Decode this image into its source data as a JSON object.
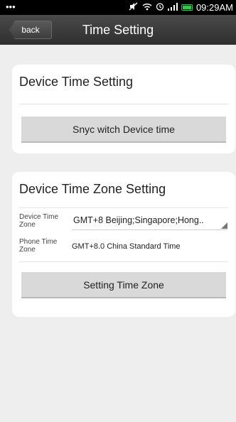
{
  "status_bar": {
    "dots": "•••",
    "time": "09:29AM",
    "icons": [
      "mute-icon",
      "wifi-icon",
      "alarm-icon",
      "signal-icon",
      "battery-icon"
    ]
  },
  "header": {
    "back_label": "back",
    "title": "Time Setting"
  },
  "device_time": {
    "title": "Device Time Setting",
    "sync_button": "Snyc witch Device time"
  },
  "time_zone": {
    "title": "Device Time Zone Setting",
    "device_zone_label": "Device Time Zone",
    "device_zone_value": "GMT+8 Beijing;Singapore;Hong..",
    "phone_zone_label": "Phone Time Zone",
    "phone_zone_value": "GMT+8.0  China Standard Time",
    "set_button": "Setting Time Zone"
  },
  "colors": {
    "status_bar": "#000000",
    "title_bar": "#3a3a3a",
    "background": "#eeeeee",
    "card": "#ffffff",
    "button": "#d9d9d9",
    "battery": "#39c24f"
  }
}
